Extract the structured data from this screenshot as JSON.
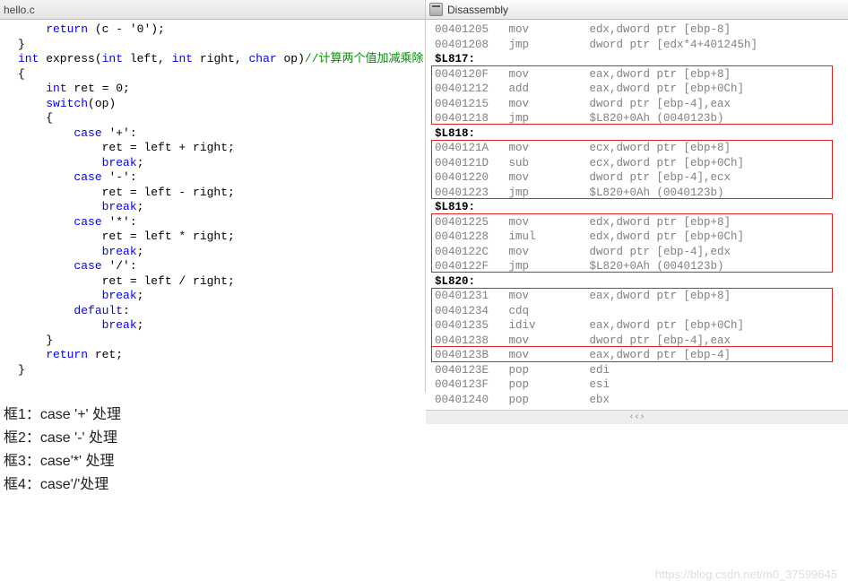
{
  "leftTab": {
    "title": "hello.c"
  },
  "rightTab": {
    "title": "Disassembly"
  },
  "code": {
    "l1a": "    ",
    "l1b": "return",
    "l1c": " (c - ",
    "l1d": "'0'",
    "l1e": ");",
    "l2": "}",
    "l3": "",
    "l4a": "int",
    "l4b": " express(",
    "l4c": "int",
    "l4d": " left, ",
    "l4e": "int",
    "l4f": " right, ",
    "l4g": "char",
    "l4h": " op)",
    "l4i": "//计算两个值加减乘除",
    "l5": "{",
    "l6a": "    ",
    "l6b": "int",
    "l6c": " ret = 0;",
    "l7": "",
    "l8a": "    ",
    "l8b": "switch",
    "l8c": "(op)",
    "l9": "    {",
    "l10a": "        ",
    "l10b": "case",
    "l10c": " ",
    "l10d": "'+'",
    "l10e": ":",
    "l11": "            ret = left + right;",
    "l12a": "            ",
    "l12b": "break",
    "l12c": ";",
    "l13a": "        ",
    "l13b": "case",
    "l13c": " ",
    "l13d": "'-'",
    "l13e": ":",
    "l14": "            ret = left - right;",
    "l15a": "            ",
    "l15b": "break",
    "l15c": ";",
    "l16a": "        ",
    "l16b": "case",
    "l16c": " ",
    "l16d": "'*'",
    "l16e": ":",
    "l17": "            ret = left * right;",
    "l18a": "            ",
    "l18b": "break",
    "l18c": ";",
    "l19a": "        ",
    "l19b": "case",
    "l19c": " ",
    "l19d": "'/'",
    "l19e": ":",
    "l20": "            ret = left / right;",
    "l21a": "            ",
    "l21b": "break",
    "l21c": ";",
    "l22a": "        ",
    "l22b": "default",
    "l22c": ":",
    "l23a": "            ",
    "l23b": "break",
    "l23c": ";",
    "l24": "    }",
    "l25": "",
    "l26a": "    ",
    "l26b": "return",
    "l26c": " ret;",
    "l27": "}"
  },
  "asm": {
    "r1": "00401205   mov         edx,dword ptr [ebp-8]",
    "r2": "00401208   jmp         dword ptr [edx*4+401245h]",
    "lb1": "$L817:",
    "r3": "0040120F   mov         eax,dword ptr [ebp+8]",
    "r4": "00401212   add         eax,dword ptr [ebp+0Ch]",
    "r5": "00401215   mov         dword ptr [ebp-4],eax",
    "r6": "00401218   jmp         $L820+0Ah (0040123b)",
    "lb2": "$L818:",
    "r7": "0040121A   mov         ecx,dword ptr [ebp+8]",
    "r8": "0040121D   sub         ecx,dword ptr [ebp+0Ch]",
    "r9": "00401220   mov         dword ptr [ebp-4],ecx",
    "r10": "00401223   jmp         $L820+0Ah (0040123b)",
    "lb3": "$L819:",
    "r11": "00401225   mov         edx,dword ptr [ebp+8]",
    "r12": "00401228   imul        edx,dword ptr [ebp+0Ch]",
    "r13": "0040122C   mov         dword ptr [ebp-4],edx",
    "r14": "0040122F   jmp         $L820+0Ah (0040123b)",
    "lb4": "$L820:",
    "r15": "00401231   mov         eax,dword ptr [ebp+8]",
    "r16": "00401234   cdq",
    "r17": "00401235   idiv        eax,dword ptr [ebp+0Ch]",
    "r18": "00401238   mov         dword ptr [ebp-4],eax",
    "r19": "0040123B   mov         eax,dword ptr [ebp-4]",
    "r20": "0040123E   pop         edi",
    "r21": "0040123F   pop         esi",
    "r22": "00401240   pop         ebx"
  },
  "notes": {
    "n1": "框1：case '+' 处理",
    "n2": "框2：case '-' 处理",
    "n3": "框3：case'*' 处理",
    "n4": "框4：case'/'处理"
  },
  "watermark": "https://blog.csdn.net/m0_37599645"
}
